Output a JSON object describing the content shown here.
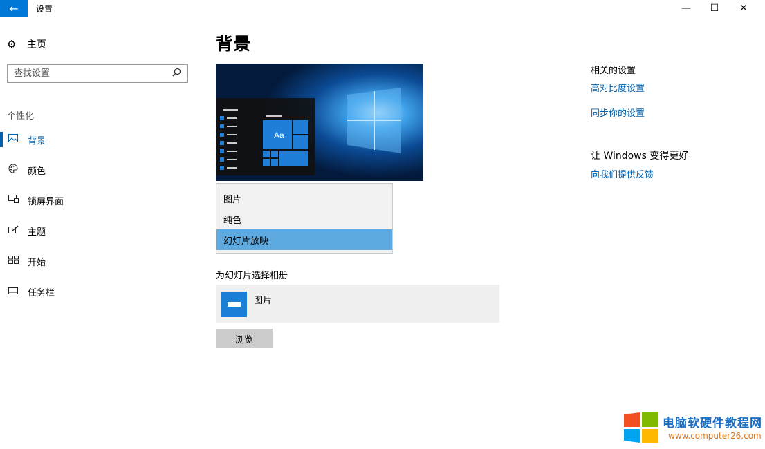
{
  "titlebar": {
    "back_glyph": "←",
    "title": "设置",
    "minimize_glyph": "—",
    "maximize_glyph": "☐",
    "close_glyph": "✕"
  },
  "sidebar": {
    "home_label": "主页",
    "search_placeholder": "查找设置",
    "group_label": "个性化",
    "items": [
      {
        "label": "背景",
        "icon": "picture-icon",
        "selected": true
      },
      {
        "label": "颜色",
        "icon": "palette-icon",
        "selected": false
      },
      {
        "label": "锁屏界面",
        "icon": "lock-screen-icon",
        "selected": false
      },
      {
        "label": "主题",
        "icon": "brush-icon",
        "selected": false
      },
      {
        "label": "开始",
        "icon": "start-icon",
        "selected": false
      },
      {
        "label": "任务栏",
        "icon": "taskbar-icon",
        "selected": false
      }
    ]
  },
  "main": {
    "title": "背景",
    "preview": {
      "tile_text": "Aa"
    },
    "background_dropdown": {
      "options": [
        "图片",
        "纯色",
        "幻灯片放映"
      ],
      "selected": "幻灯片放映"
    },
    "album_label": "为幻灯片选择相册",
    "album_name": "图片",
    "browse_label": "浏览"
  },
  "related": {
    "heading": "相关的设置",
    "links": [
      "高对比度设置",
      "同步你的设置"
    ],
    "feedback_heading": "让 Windows 变得更好",
    "feedback_link": "向我们提供反馈"
  },
  "watermark": {
    "name": "电脑软硬件教程网",
    "url": "www.computer26.com"
  },
  "colors": {
    "accent": "#0078d7",
    "link": "#0063b1",
    "dropdown_selected": "#5ea9e0",
    "logo_red": "#f25022",
    "logo_green": "#7fba00",
    "logo_blue": "#00a4ef",
    "logo_yellow": "#ffb900"
  }
}
